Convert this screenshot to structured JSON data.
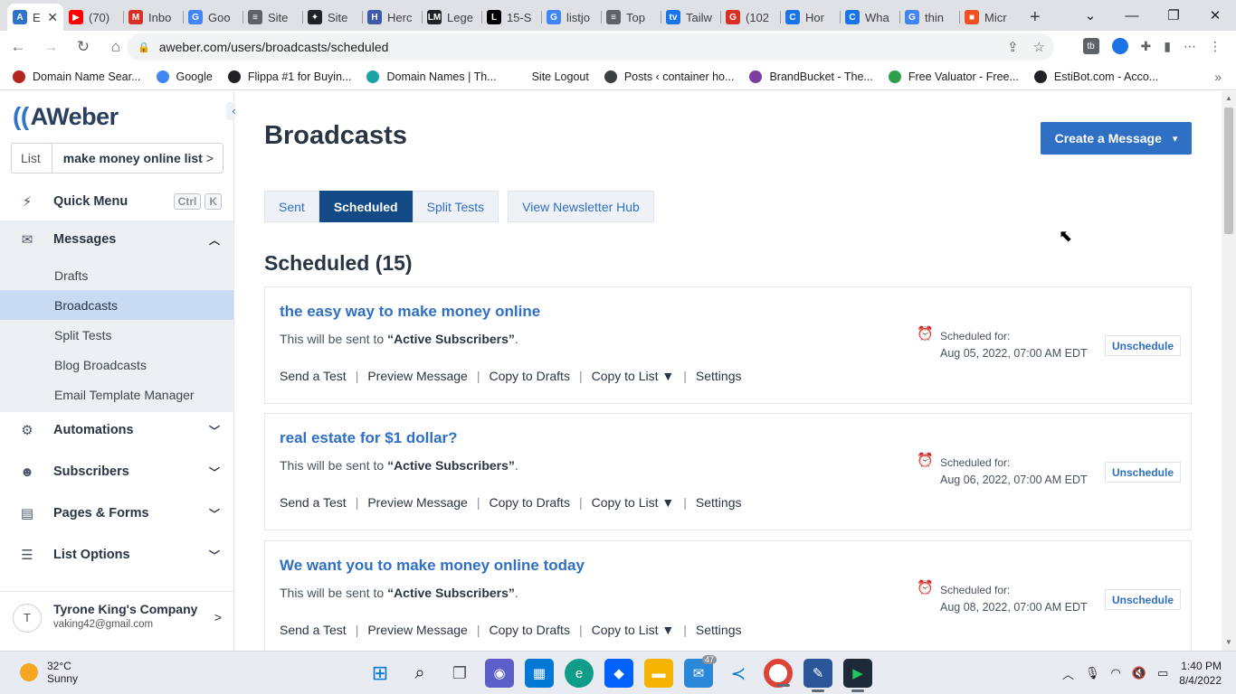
{
  "browser": {
    "tabs": [
      {
        "label": "E",
        "icon": "aweber-icon",
        "color": "#2f74c7",
        "glyph": "A",
        "active": true
      },
      {
        "label": "(70)",
        "icon": "youtube-icon",
        "color": "#ff0000",
        "glyph": "▶"
      },
      {
        "label": "Inbo",
        "icon": "gmail-icon",
        "color": "#d93025",
        "glyph": "M"
      },
      {
        "label": "Goo",
        "icon": "google-icon",
        "color": "#4285f4",
        "glyph": "G"
      },
      {
        "label": "Site",
        "icon": "site-icon",
        "color": "#5f6368",
        "glyph": "≡"
      },
      {
        "label": "Site",
        "icon": "site-icon",
        "color": "#202124",
        "glyph": "✦"
      },
      {
        "label": "Herc",
        "icon": "hercules-icon",
        "color": "#3b5ba9",
        "glyph": "H"
      },
      {
        "label": "Lege",
        "icon": "lm-icon",
        "color": "#202124",
        "glyph": "LM"
      },
      {
        "label": "15-S",
        "icon": "l-icon",
        "color": "#000000",
        "glyph": "L"
      },
      {
        "label": "listjo",
        "icon": "google-icon",
        "color": "#4285f4",
        "glyph": "G"
      },
      {
        "label": "Top",
        "icon": "site-icon",
        "color": "#5f6368",
        "glyph": "≡"
      },
      {
        "label": "Tailw",
        "icon": "tailwind-icon",
        "color": "#1a73e8",
        "glyph": "tv"
      },
      {
        "label": "(102",
        "icon": "g-red-icon",
        "color": "#d93025",
        "glyph": "G"
      },
      {
        "label": "Hor",
        "icon": "c-icon",
        "color": "#1a73e8",
        "glyph": "C"
      },
      {
        "label": "Wha",
        "icon": "c-icon",
        "color": "#1a73e8",
        "glyph": "C"
      },
      {
        "label": "thin",
        "icon": "google-icon",
        "color": "#4285f4",
        "glyph": "G"
      },
      {
        "label": "Micr",
        "icon": "microsoft-icon",
        "color": "#f25022",
        "glyph": "■"
      }
    ],
    "url": "aweber.com/users/broadcasts/scheduled",
    "bookmarks": [
      {
        "label": "Domain Name Sear...",
        "color": "#b3261e"
      },
      {
        "label": "Google",
        "color": "#4285f4"
      },
      {
        "label": "Flippa #1 for Buyin...",
        "color": "#202124"
      },
      {
        "label": "Domain Names | Th...",
        "color": "#1aa3a3"
      },
      {
        "label": "Site Logout",
        "color": "#ffffff"
      },
      {
        "label": "Posts ‹ container ho...",
        "color": "#3c4043"
      },
      {
        "label": "BrandBucket - The...",
        "color": "#7b3fa0"
      },
      {
        "label": "Free Valuator - Free...",
        "color": "#2e9e4b"
      },
      {
        "label": "EstiBot.com - Acco...",
        "color": "#202124"
      }
    ]
  },
  "sidebar": {
    "logo": "AWeber",
    "list_label": "List",
    "list_value": "make money online list",
    "quick_menu": "Quick Menu",
    "shortcut_keys": [
      "Ctrl",
      "K"
    ],
    "messages": "Messages",
    "message_items": [
      "Drafts",
      "Broadcasts",
      "Split Tests",
      "Blog Broadcasts",
      "Email Template Manager"
    ],
    "automations": "Automations",
    "subscribers": "Subscribers",
    "pages_forms": "Pages & Forms",
    "list_options": "List Options",
    "account_name": "Tyrone King's Company",
    "account_email": "vaking42@gmail.com",
    "account_initial": "T"
  },
  "main": {
    "title": "Broadcasts",
    "create_button": "Create a Message",
    "tabs": [
      "Sent",
      "Scheduled",
      "Split Tests"
    ],
    "hub_button": "View Newsletter Hub",
    "scheduled_heading": "Scheduled (15)",
    "broadcasts": [
      {
        "subject": "the easy way to make money online",
        "sent_prefix": "This will be sent to ",
        "audience": "“Active Subscribers”",
        "sent_suffix": ".",
        "scheduled_label": "Scheduled for:",
        "scheduled_date": "Aug 05, 2022, 07:00 AM EDT"
      },
      {
        "subject": "real estate for $1 dollar?",
        "sent_prefix": "This will be sent to ",
        "audience": "“Active Subscribers”",
        "sent_suffix": ".",
        "scheduled_label": "Scheduled for:",
        "scheduled_date": "Aug 06, 2022, 07:00 AM EDT"
      },
      {
        "subject": "We want you to make money online today",
        "sent_prefix": "This will be sent to ",
        "audience": "“Active Subscribers”",
        "sent_suffix": ".",
        "scheduled_label": "Scheduled for:",
        "scheduled_date": "Aug 08, 2022, 07:00 AM EDT"
      }
    ],
    "actions": {
      "send_test": "Send a Test",
      "preview": "Preview Message",
      "copy_drafts": "Copy to Drafts",
      "copy_list": "Copy to List ▼",
      "settings": "Settings"
    },
    "unschedule": "Unschedule"
  },
  "taskbar": {
    "temperature": "32°C",
    "condition": "Sunny",
    "mail_badge": "47",
    "time": "1:40 PM",
    "date": "8/4/2022"
  },
  "colors": {
    "brand_blue": "#2f6fc4",
    "active_tab": "#144a86",
    "selected_nav": "#c9daf3"
  }
}
